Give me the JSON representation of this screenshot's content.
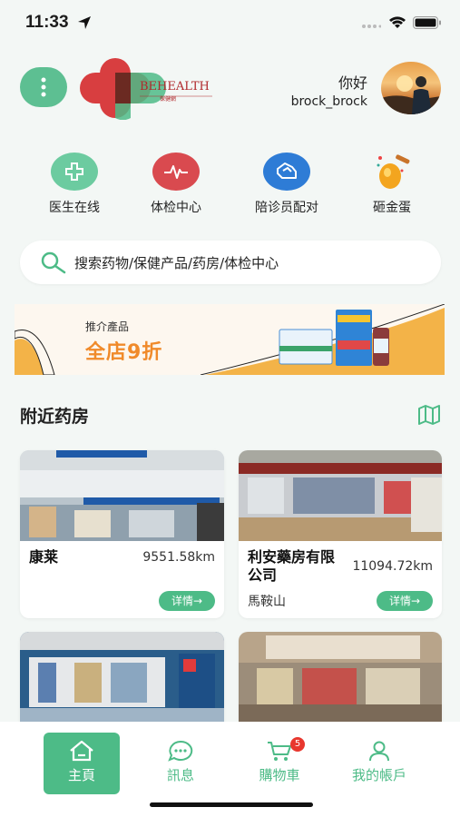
{
  "status_bar": {
    "time": "11:33"
  },
  "header": {
    "logo_text": "BEHEALTH",
    "logo_sub": "保健網",
    "greeting": "你好",
    "username": "brock_brock"
  },
  "quick_actions": [
    {
      "label": "医生在线",
      "icon": "medical-cross-icon",
      "color": "#5dbf92"
    },
    {
      "label": "体检中心",
      "icon": "heartbeat-icon",
      "color": "#d94a4f"
    },
    {
      "label": "陪诊员配对",
      "icon": "handshake-icon",
      "color": "#2e7cd6"
    },
    {
      "label": "砸金蛋",
      "icon": "golden-egg-icon",
      "color": "#f0a020"
    }
  ],
  "search": {
    "placeholder": "搜索药物/保健产品/药房/体检中心"
  },
  "banner": {
    "subtitle": "推介產品",
    "title": "全店9折"
  },
  "nearby": {
    "title": "附近药房",
    "cards": [
      {
        "name": "康莱",
        "distance": "9551.58km",
        "area": "",
        "detail_label": "详情→"
      },
      {
        "name": "利安藥房有限公司",
        "distance": "11094.72km",
        "area": "馬鞍山",
        "detail_label": "详情→"
      }
    ]
  },
  "tabbar": {
    "tabs": [
      {
        "label": "主頁",
        "icon": "home-icon",
        "active": true
      },
      {
        "label": "訊息",
        "icon": "chat-icon",
        "active": false
      },
      {
        "label": "購物車",
        "icon": "cart-icon",
        "active": false
      },
      {
        "label": "我的帳戶",
        "icon": "user-icon",
        "active": false
      }
    ],
    "cart_badge": "5"
  },
  "colors": {
    "accent": "#4dbb87",
    "background": "#f3f7f5",
    "banner_orange": "#f08a2a"
  }
}
